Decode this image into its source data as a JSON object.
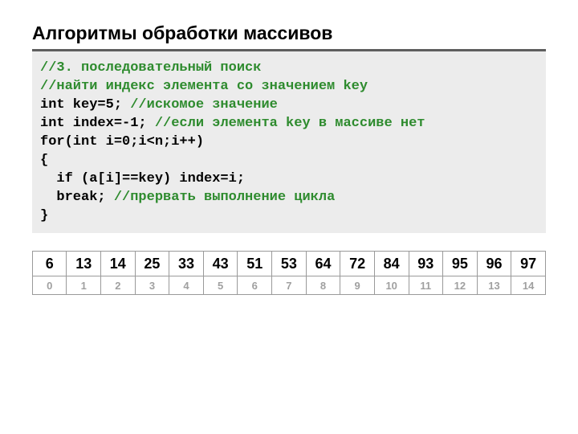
{
  "title": "Алгоритмы обработки массивов",
  "code": {
    "lines": [
      {
        "parts": [
          {
            "cls": "c-comment",
            "t": "//3. последовательный поиск"
          }
        ]
      },
      {
        "parts": [
          {
            "cls": "c-comment",
            "t": "//найти индекс элемента со значением key"
          }
        ]
      },
      {
        "parts": [
          {
            "cls": "c-code",
            "t": "int key=5; "
          },
          {
            "cls": "c-comment",
            "t": "//искомое значение"
          }
        ]
      },
      {
        "parts": [
          {
            "cls": "c-code",
            "t": "int index=-1; "
          },
          {
            "cls": "c-comment",
            "t": "//если элемента key в массиве нет"
          }
        ]
      },
      {
        "parts": [
          {
            "cls": "c-code",
            "t": "for(int i=0;i<n;i++)"
          }
        ]
      },
      {
        "parts": [
          {
            "cls": "c-code",
            "t": "{"
          }
        ]
      },
      {
        "parts": [
          {
            "cls": "c-code",
            "t": "  if (a[i]==key) index=i;"
          }
        ]
      },
      {
        "parts": [
          {
            "cls": "c-code",
            "t": "  break; "
          },
          {
            "cls": "c-comment",
            "t": "//прервать выполнение цикла"
          }
        ]
      },
      {
        "parts": [
          {
            "cls": "c-code",
            "t": "}"
          }
        ]
      }
    ]
  },
  "array": {
    "values": [
      6,
      13,
      14,
      25,
      33,
      43,
      51,
      53,
      64,
      72,
      84,
      93,
      95,
      96,
      97
    ],
    "indices": [
      0,
      1,
      2,
      3,
      4,
      5,
      6,
      7,
      8,
      9,
      10,
      11,
      12,
      13,
      14
    ]
  }
}
